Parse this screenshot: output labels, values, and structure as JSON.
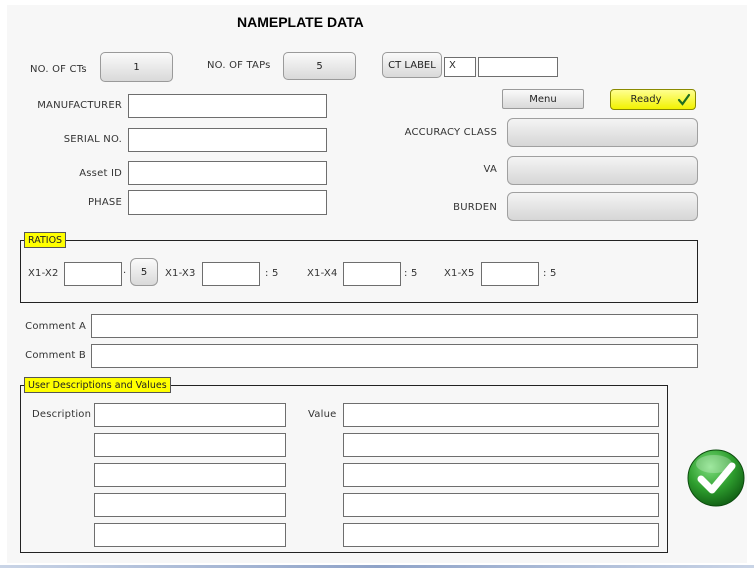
{
  "header": {
    "title": "NAMEPLATE DATA"
  },
  "top_row": {
    "no_of_cts_label": "NO. OF CTs",
    "no_of_cts_value": "1",
    "no_of_taps_label": "NO. OF TAPs",
    "no_of_taps_value": "5",
    "ct_label_button": "CT LABEL",
    "ct_label_prefix": "X",
    "ct_label_value": ""
  },
  "left_fields": {
    "manufacturer_label": "MANUFACTURER",
    "manufacturer_value": "",
    "serial_label": "SERIAL NO.",
    "serial_value": "",
    "asset_label": "Asset ID",
    "asset_value": "",
    "phase_label": "PHASE",
    "phase_value": ""
  },
  "right_fields": {
    "menu_button": "Menu",
    "ready_button": "Ready",
    "accuracy_class_label": "ACCURACY CLASS",
    "accuracy_class_value": "",
    "va_label": "VA",
    "va_value": "",
    "burden_label": "BURDEN",
    "burden_value": ""
  },
  "ratios": {
    "legend": "RATIOS",
    "items": [
      {
        "label": "X1-X2",
        "value": "",
        "ratio": "5"
      },
      {
        "label": "X1-X3",
        "value": "",
        "ratio": ": 5"
      },
      {
        "label": "X1-X4",
        "value": "",
        "ratio": ": 5"
      },
      {
        "label": "X1-X5",
        "value": "",
        "ratio": ": 5"
      }
    ]
  },
  "comments": {
    "comment_a_label": "Comment A",
    "comment_a_value": "",
    "comment_b_label": "Comment B",
    "comment_b_value": ""
  },
  "user_desc": {
    "legend": "User Descriptions and Values",
    "description_label": "Description",
    "value_label": "Value",
    "rows": [
      {
        "description": "",
        "value": ""
      },
      {
        "description": "",
        "value": ""
      },
      {
        "description": "",
        "value": ""
      },
      {
        "description": "",
        "value": ""
      },
      {
        "description": "",
        "value": ""
      }
    ]
  },
  "colors": {
    "highlight": "#ffff00",
    "confirm": "#2e9e2e",
    "panel": "#f7f7f7"
  },
  "icons": {
    "ready": "checkmark-icon",
    "confirm": "green-check-circle-icon"
  }
}
